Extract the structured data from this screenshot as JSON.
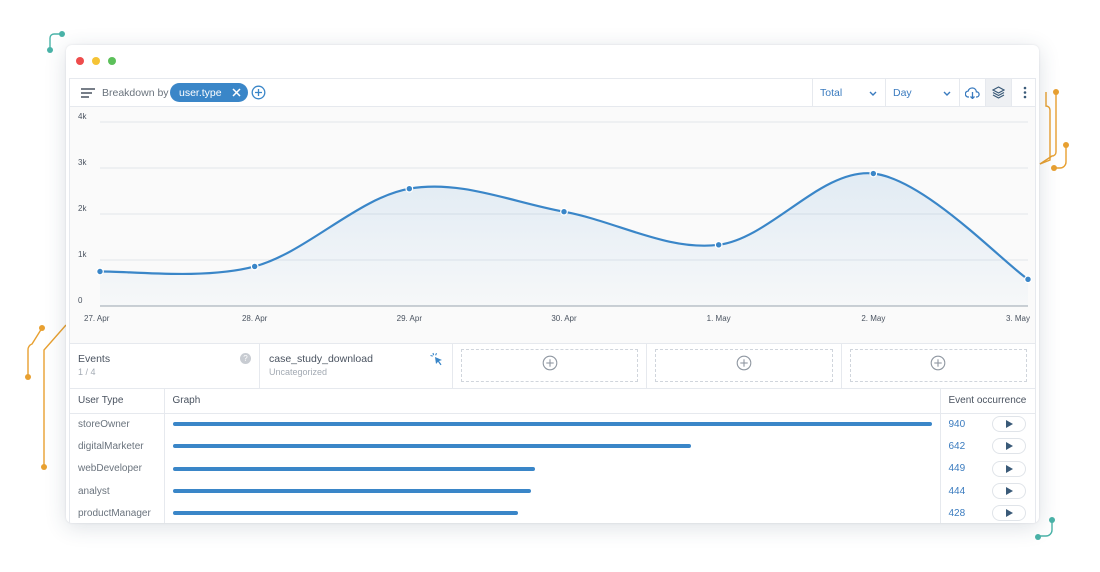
{
  "toolbar": {
    "breakdown_label": "Breakdown by",
    "chip_label": "user.type",
    "total_select": "Total",
    "interval_select": "Day"
  },
  "chart_data": {
    "type": "area",
    "x": [
      "27. Apr",
      "28. Apr",
      "29. Apr",
      "30. Apr",
      "1. May",
      "2. May",
      "3. May"
    ],
    "series": [
      {
        "values": [
          750,
          860,
          2550,
          2050,
          1330,
          2880,
          580
        ]
      }
    ],
    "y_ticks": [
      "0",
      "1k",
      "2k",
      "3k",
      "4k"
    ],
    "ylim": [
      0,
      4000
    ],
    "grid": true,
    "color": "#3a86c8"
  },
  "cards": {
    "events": {
      "title": "Events",
      "sub": "1 / 4",
      "help": "?"
    },
    "event": {
      "title": "case_study_download",
      "sub": "Uncategorized"
    }
  },
  "table": {
    "headers": {
      "type": "User Type",
      "graph": "Graph",
      "occurrence": "Event occurrence"
    },
    "max": 940,
    "rows": [
      {
        "type": "storeOwner",
        "value": 940
      },
      {
        "type": "digitalMarketer",
        "value": 642
      },
      {
        "type": "webDeveloper",
        "value": 449
      },
      {
        "type": "analyst",
        "value": 444
      },
      {
        "type": "productManager",
        "value": 428
      }
    ]
  }
}
